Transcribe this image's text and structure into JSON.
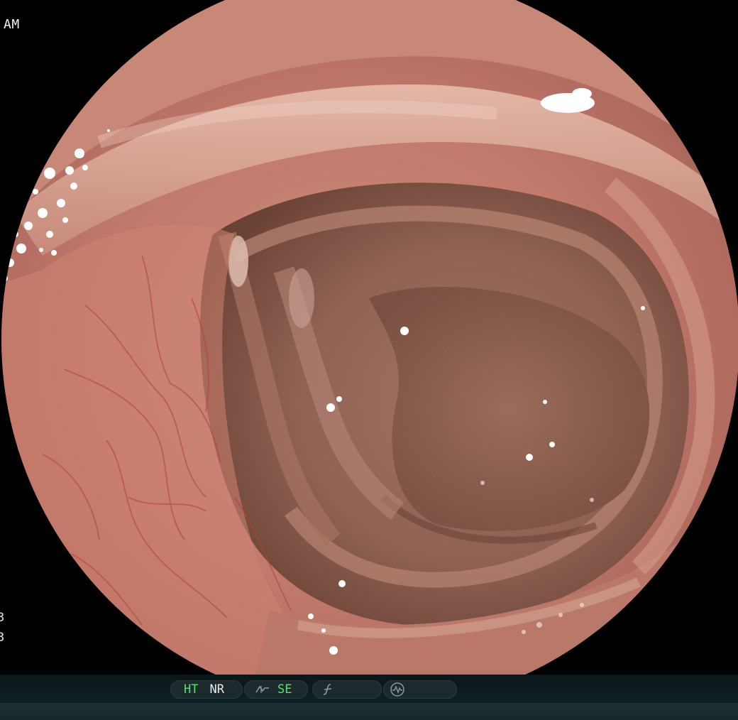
{
  "overlay": {
    "corner_label": "AM",
    "edge_numbers": [
      "3",
      "3"
    ]
  },
  "status_bar": {
    "ht_label": "HT",
    "nr_label": "NR",
    "se_label": "SE",
    "icons": [
      "structure-enhance-icon",
      "function-icon",
      "waveform-circle-icon"
    ]
  },
  "colors": {
    "active_indicator": "#56e36a",
    "inactive_indicator": "#e8e8e8",
    "status_bar_bg": "#0f2024"
  }
}
